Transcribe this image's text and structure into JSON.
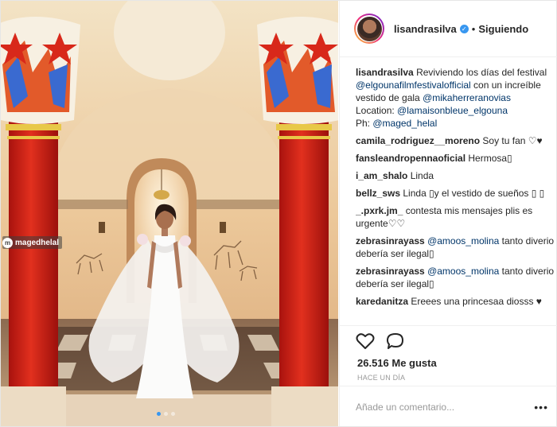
{
  "photo": {
    "watermark": "magedhelal",
    "carousel_dots": 3,
    "active_dot": 0
  },
  "header": {
    "username": "lisandrasilva",
    "separator": "•",
    "follow_status": "Siguiendo"
  },
  "caption": {
    "username": "lisandrasilva",
    "text": "Reviviendo los días del festival",
    "mention_festival": "@elgounafilmfestivalofficial",
    "text2": "con un increíble vestido de gala",
    "mention_dress": "@mikaherreranovias",
    "location_label": "Location:",
    "mention_location": "@lamaisonbleue_elgouna",
    "ph_label": "Ph:",
    "mention_photo": "@maged_helal"
  },
  "comments": [
    {
      "user": "camila_rodriguez__moreno",
      "text": "Soy tu fan ♡♥"
    },
    {
      "user": "fansleandropennaoficial",
      "text": "Hermosa▯"
    },
    {
      "user": "i_am_shalo",
      "text": "Linda"
    },
    {
      "user": "bellz_sws",
      "text": "Linda ▯y el vestido de sueños ▯ ▯"
    },
    {
      "user": "_.pxrk.jm_",
      "text": "contesta mis mensajes plis es urgente♡♡"
    },
    {
      "user": "zebrasinrayass",
      "mention": "@amoos_molina",
      "text": "tanto diverio debería ser ilegal▯"
    },
    {
      "user": "zebrasinrayass",
      "mention": "@amoos_molina",
      "text": "tanto diverio debería ser ilegal▯"
    },
    {
      "user": "karedanitza",
      "text": "Ereees una princesaa diosss ♥"
    }
  ],
  "actions": {
    "like_icon": "heart-icon",
    "comment_icon": "comment-bubble-icon",
    "likes_count": "26.516 Me gusta",
    "timestamp": "HACE UN DÍA"
  },
  "add_comment": {
    "placeholder": "Añade un comentario...",
    "more_label": "•••"
  }
}
